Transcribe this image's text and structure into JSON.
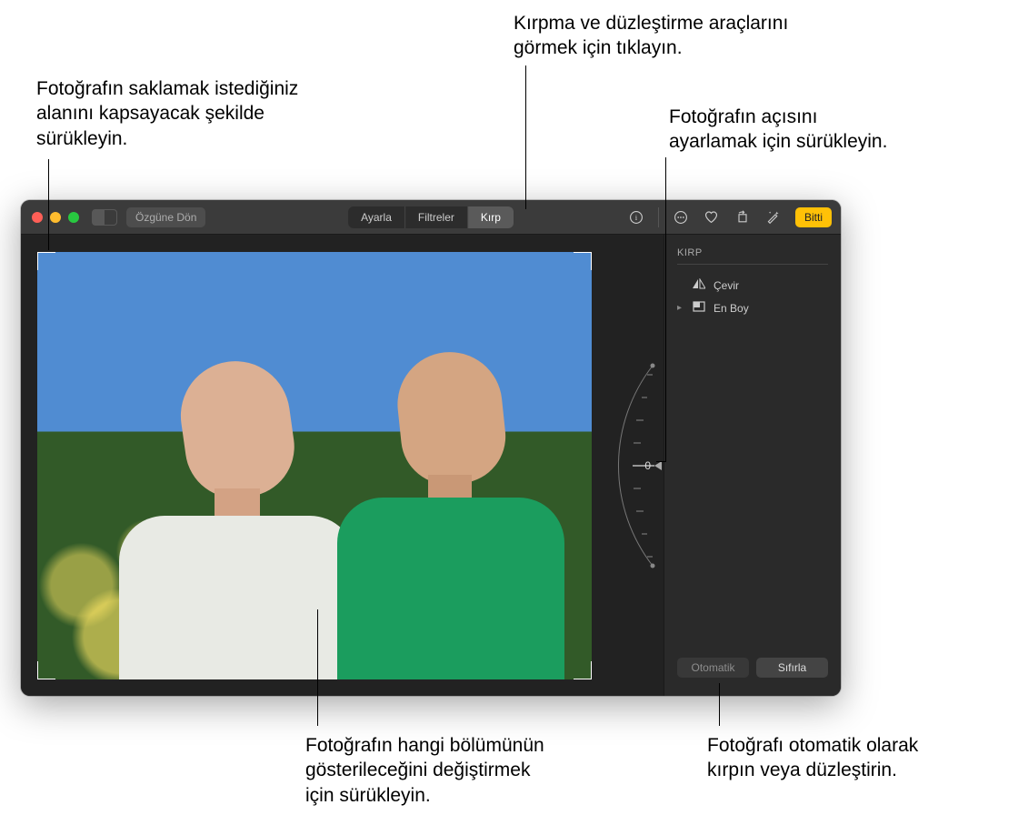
{
  "callouts": {
    "crop_tools": "Kırpma ve düzleştirme araçlarını\ngörmek için tıklayın.",
    "drag_area": "Fotoğrafın saklamak istediğiniz\nalanını kapsayacak şekilde\nsürükleyin.",
    "angle_drag": "Fotoğrafın açısını\nayarlamak için sürükleyin.",
    "move_drag": "Fotoğrafın hangi bölümünün\ngösterileceğini değiştirmek\niçin sürükleyin.",
    "auto_crop": "Fotoğrafı otomatik olarak\nkırpın veya düzleştirin."
  },
  "toolbar": {
    "revert_label": "Özgüne Dön",
    "tabs": {
      "adjust": "Ayarla",
      "filters": "Filtreler",
      "crop": "Kırp"
    },
    "done_label": "Bitti"
  },
  "sidebar": {
    "title": "KIRP",
    "flip_label": "Çevir",
    "aspect_label": "En Boy",
    "auto_label": "Otomatik",
    "reset_label": "Sıfırla"
  },
  "dial": {
    "value": "0"
  }
}
